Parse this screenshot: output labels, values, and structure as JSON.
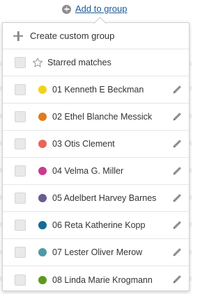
{
  "trigger": {
    "label": "Add to group",
    "icon": "plus-circle-icon"
  },
  "dropdown": {
    "create_label": "Create custom group",
    "starred_label": "Starred matches",
    "groups": [
      {
        "label": "01 Kenneth E Beckman",
        "color": "#f2d21a"
      },
      {
        "label": "02 Ethel Blanche Messick",
        "color": "#e07b1c"
      },
      {
        "label": "03 Otis Clement",
        "color": "#e8665a"
      },
      {
        "label": "04 Velma G. Miller",
        "color": "#cc3b8e"
      },
      {
        "label": "05 Adelbert Harvey Barnes",
        "color": "#6b5b95"
      },
      {
        "label": "06 Reta Katherine Kopp",
        "color": "#146b94"
      },
      {
        "label": "07 Lester Oliver Merow",
        "color": "#4a9ba5"
      },
      {
        "label": "08 Linda Marie Krogmann",
        "color": "#5b9a1e"
      }
    ]
  }
}
